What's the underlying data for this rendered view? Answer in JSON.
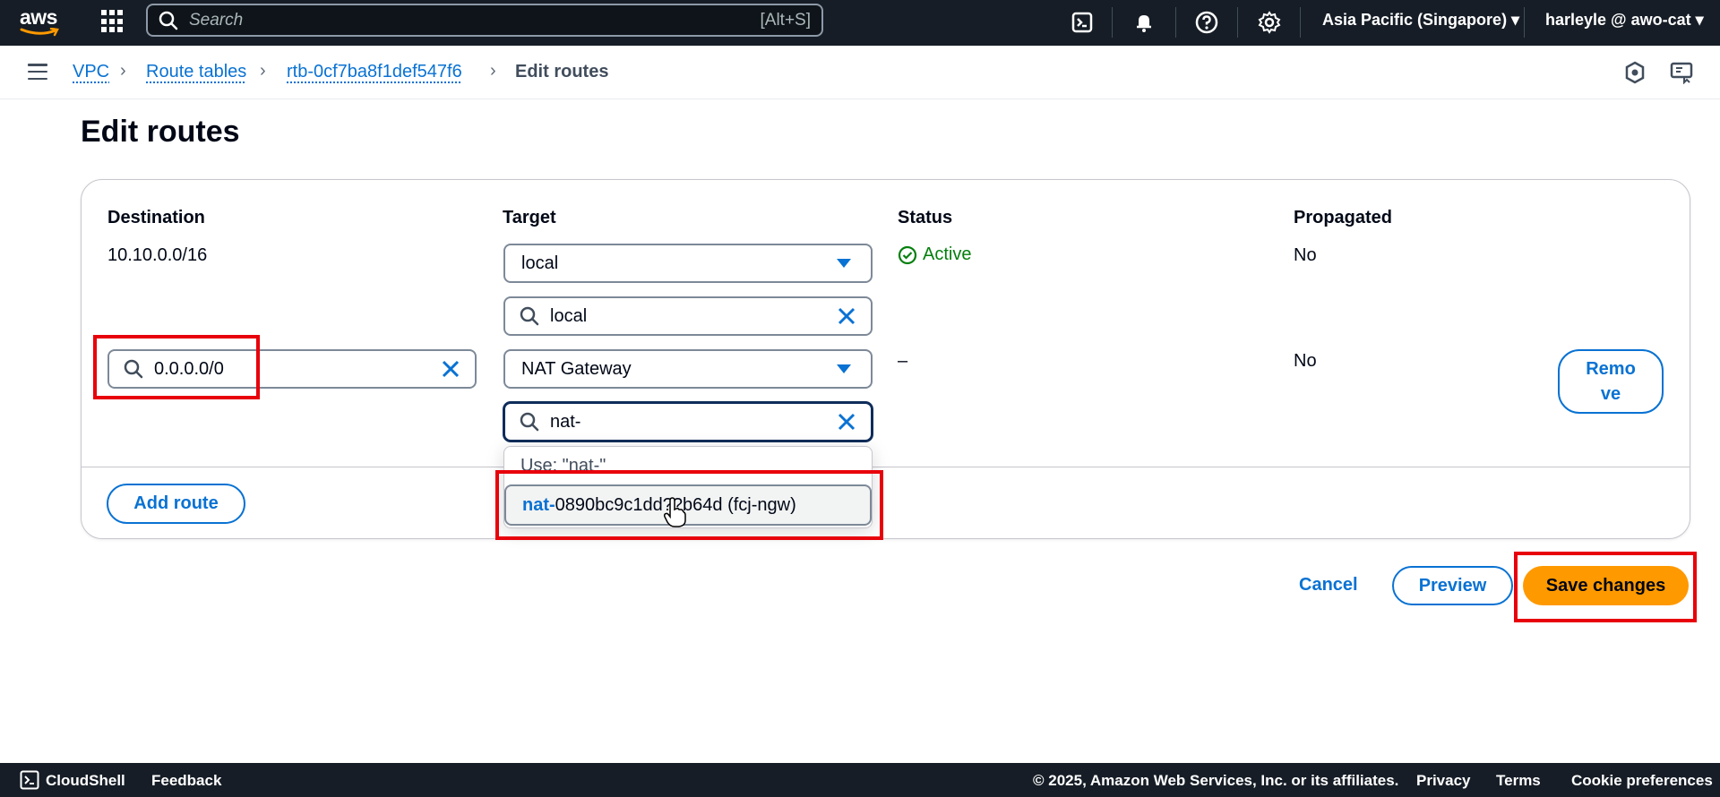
{
  "topnav": {
    "logo_text": "aws",
    "search_placeholder": "Search",
    "search_shortcut": "[Alt+S]",
    "region": "Asia Pacific (Singapore) ▾",
    "account": "harleyle @ awo-cat ▾",
    "icons": [
      "services-grid-icon",
      "search-icon",
      "cloudshell-icon",
      "bell-icon",
      "help-icon",
      "settings-icon"
    ]
  },
  "breadcrumb": {
    "items": [
      {
        "label": "VPC"
      },
      {
        "label": "Route tables"
      },
      {
        "label": "rtb-0cf7ba8f1def547f6"
      },
      {
        "label": "Edit routes"
      }
    ]
  },
  "page": {
    "title": "Edit routes"
  },
  "table": {
    "headers": {
      "destination": "Destination",
      "target": "Target",
      "status": "Status",
      "propagated": "Propagated"
    },
    "rows": [
      {
        "destination": "10.10.0.0/16",
        "target": "local",
        "target_filter": "local",
        "status": "Active",
        "propagated": "No"
      },
      {
        "destination": "0.0.0.0/0",
        "target": "NAT Gateway",
        "target_filter": "nat-",
        "status": "–",
        "propagated": "No",
        "remove_label": "Remo ve"
      }
    ]
  },
  "dropdown": {
    "use_option": "Use: \"nat-\"",
    "option_highlight": "nat-",
    "option_rest": "0890bc9c1dd??b64d (fcj-ngw)"
  },
  "actions": {
    "add_route": "Add route",
    "cancel": "Cancel",
    "preview": "Preview",
    "save": "Save changes"
  },
  "footer": {
    "cloudshell": "CloudShell",
    "feedback": "Feedback",
    "copyright": "© 2025, Amazon Web Services, Inc. or its affiliates.",
    "privacy": "Privacy",
    "terms": "Terms",
    "cookie": "Cookie preferences"
  },
  "colors": {
    "accent": "#0972d3",
    "primary_button": "#ff9900",
    "status_active": "#037f0c",
    "annotation": "#e8000b",
    "nav_bg": "#161d26"
  }
}
